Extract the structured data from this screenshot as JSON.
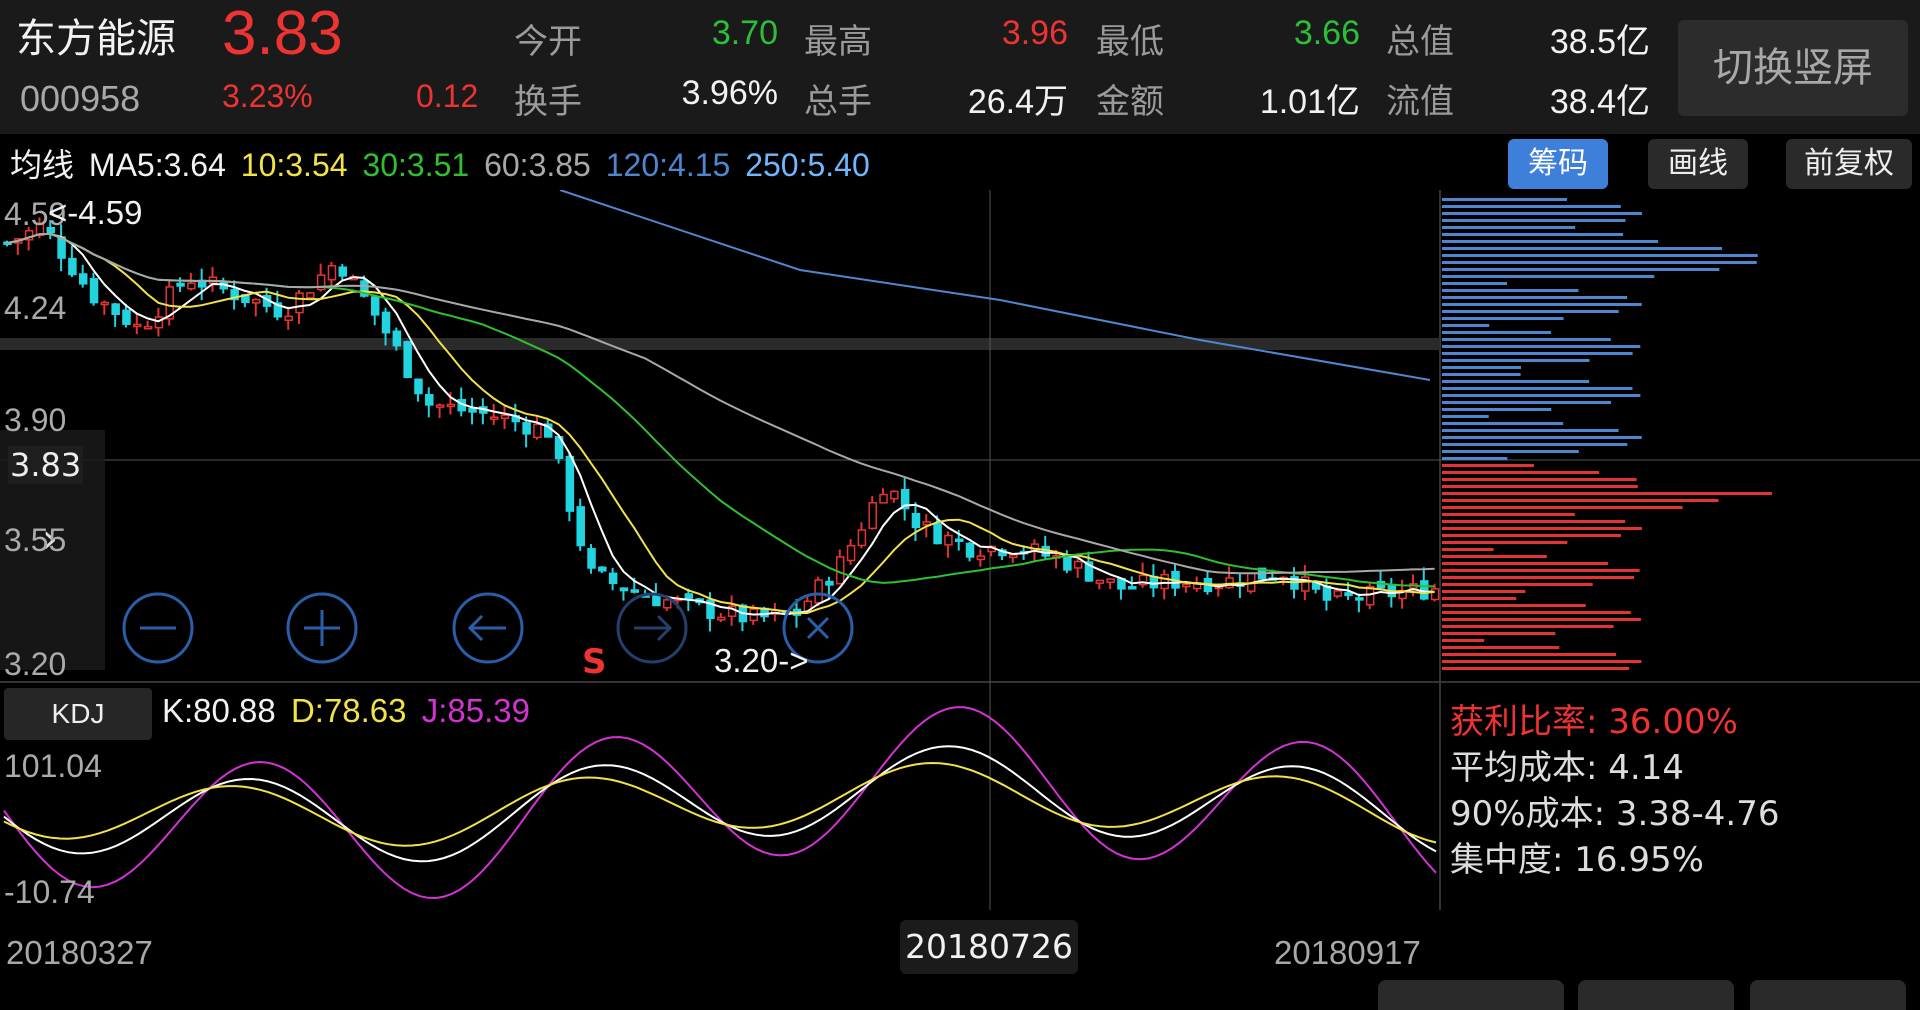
{
  "stock": {
    "name": "东方能源",
    "price": "3.83",
    "code": "000958",
    "change_pct": "3.23%",
    "change": "0.12"
  },
  "stats": [
    {
      "label": "今开",
      "value": "3.70",
      "color": "green"
    },
    {
      "label": "最高",
      "value": "3.96",
      "color": "red"
    },
    {
      "label": "最低",
      "value": "3.66",
      "color": "green"
    },
    {
      "label": "总值",
      "value": "38.5亿",
      "color": "white"
    },
    {
      "label": "换手",
      "value": "3.96%",
      "color": "white"
    },
    {
      "label": "总手",
      "value": "26.4万",
      "color": "white"
    },
    {
      "label": "金额",
      "value": "1.01亿",
      "color": "white"
    },
    {
      "label": "流值",
      "value": "38.4亿",
      "color": "white"
    }
  ],
  "switch_button": "切换竖屏",
  "ma": {
    "label": "均线",
    "ma5": "MA5:3.64",
    "ma10": "10:3.54",
    "ma30": "30:3.51",
    "ma60": "60:3.85",
    "ma120": "120:4.15",
    "ma250": "250:5.40"
  },
  "top_buttons": {
    "chips": "筹码",
    "draw": "画线",
    "restore": "前复权"
  },
  "price_axis": {
    "p1": "4.24",
    "p2": "3.90",
    "p3": "3.83",
    "p4": "3.55",
    "p5": "3.20",
    "p0": "4.59"
  },
  "annotations": {
    "high": "<-4.59",
    "low": "3.20->",
    "sell_marker": "S"
  },
  "kdj": {
    "label": "KDJ",
    "k": "K:80.88",
    "d": "D:78.63",
    "j": "J:85.39",
    "axis_top": "101.04",
    "axis_bottom": "-10.74"
  },
  "chip_info": {
    "profit": "获利比率: 36.00%",
    "avg_cost": "平均成本: 4.14",
    "cost_90": "90%成本: 3.38-4.76",
    "concentration": "集中度: 16.95%"
  },
  "dates": {
    "start": "20180327",
    "cursor": "20180726",
    "end": "20180917"
  },
  "colors": {
    "up": "#e33333",
    "down": "#22d3e0",
    "ma5": "#ffffff",
    "ma10": "#f2e24a",
    "ma30": "#2fbf2f",
    "ma60": "#a8a8a8",
    "ma120": "#4f86d0",
    "ma250": "#6fb8ff",
    "kdj_j": "#d233d2"
  }
}
